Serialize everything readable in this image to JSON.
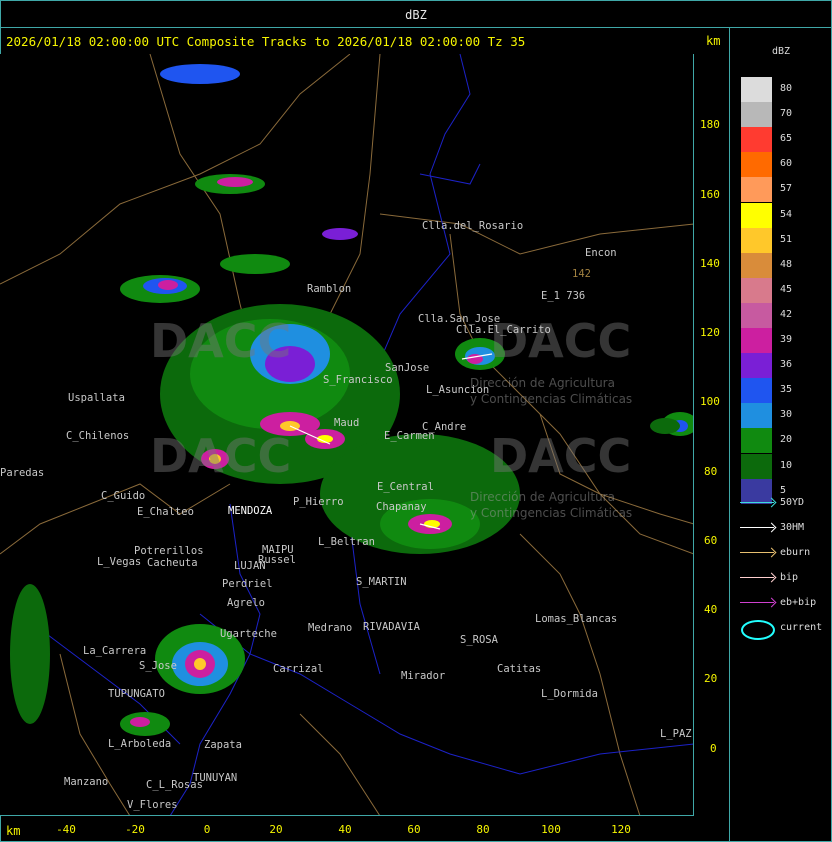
{
  "window": {
    "title": "dBZ"
  },
  "header": {
    "text": "2026/01/18 02:00:00 UTC Composite Tracks to 2026/01/18 02:00:00 Tz 35",
    "unit_top": "km",
    "unit_bottom": "km"
  },
  "axes": {
    "y_ticks": [
      "180",
      "160",
      "140",
      "120",
      "100",
      "80",
      "60",
      "40",
      "20",
      "0"
    ],
    "x_ticks": [
      "-40",
      "-20",
      "0",
      "20",
      "40",
      "60",
      "80",
      "100",
      "120"
    ]
  },
  "legend": {
    "title": "dBZ",
    "levels": [
      {
        "label": "80",
        "color": "#dcdcdc"
      },
      {
        "label": "70",
        "color": "#b8b8b8"
      },
      {
        "label": "65",
        "color": "#ff3b30"
      },
      {
        "label": "60",
        "color": "#ff6a00"
      },
      {
        "label": "57",
        "color": "#ff9a5a"
      },
      {
        "label": "54",
        "color": "#ffff00"
      },
      {
        "label": "51",
        "color": "#ffc82a"
      },
      {
        "label": "48",
        "color": "#d98c3a"
      },
      {
        "label": "45",
        "color": "#d87a8c"
      },
      {
        "label": "42",
        "color": "#c75aa0"
      },
      {
        "label": "39",
        "color": "#cc1fa0"
      },
      {
        "label": "36",
        "color": "#7a1fd6"
      },
      {
        "label": "35",
        "color": "#1f55f0"
      },
      {
        "label": "30",
        "color": "#1f8fe0"
      },
      {
        "label": "20",
        "color": "#108a10"
      },
      {
        "label": "10",
        "color": "#0c6a0c"
      },
      {
        "label": "5",
        "color": "#3a3aa0"
      }
    ],
    "tracks": [
      {
        "label": "50YD",
        "color": "#3cdcdc"
      },
      {
        "label": "30HM",
        "color": "#ffffff"
      },
      {
        "label": "eburn",
        "color": "#e8c070"
      },
      {
        "label": "bip",
        "color": "#ffd0d0"
      },
      {
        "label": "eb+bip",
        "color": "#d040d0"
      }
    ],
    "current_label": "current"
  },
  "places": [
    {
      "name": "Clla.del_Rosario"
    },
    {
      "name": "Encon"
    },
    {
      "name": "142"
    },
    {
      "name": "E_1 736"
    },
    {
      "name": "Ramblon"
    },
    {
      "name": "Clla.San_Jose"
    },
    {
      "name": "Clla.El_Carrito"
    },
    {
      "name": "Uspallata"
    },
    {
      "name": "S_Francisco"
    },
    {
      "name": "SanJose"
    },
    {
      "name": "L_Asuncion"
    },
    {
      "name": "C_Chilenos"
    },
    {
      "name": "Maud"
    },
    {
      "name": "E_Carmen"
    },
    {
      "name": "C_Andre"
    },
    {
      "name": "Paredas"
    },
    {
      "name": "E_Central"
    },
    {
      "name": "C_Guido"
    },
    {
      "name": "E_Chalteo"
    },
    {
      "name": "MENDOZA"
    },
    {
      "name": "P_Hierro"
    },
    {
      "name": "Chapanay"
    },
    {
      "name": "Potrerillos"
    },
    {
      "name": "Cacheuta"
    },
    {
      "name": "L_Vegas"
    },
    {
      "name": "LUJAN"
    },
    {
      "name": "MAIPU"
    },
    {
      "name": "Russel"
    },
    {
      "name": "Perdriel"
    },
    {
      "name": "Agrelo"
    },
    {
      "name": "S_MARTIN"
    },
    {
      "name": "L_Beltran"
    },
    {
      "name": "Lomas_Blancas"
    },
    {
      "name": "La_Carrera"
    },
    {
      "name": "S_Jose"
    },
    {
      "name": "Carrizal"
    },
    {
      "name": "Medrano"
    },
    {
      "name": "RIVADAVIA"
    },
    {
      "name": "S_ROSA"
    },
    {
      "name": "Catitas"
    },
    {
      "name": "Mirador"
    },
    {
      "name": "Ugarteche"
    },
    {
      "name": "TUPUNGATO"
    },
    {
      "name": "L_Dormida"
    },
    {
      "name": "L_Arboleda"
    },
    {
      "name": "Zapata"
    },
    {
      "name": "TUNUYAN"
    },
    {
      "name": "Manzano"
    },
    {
      "name": "V_Flores"
    },
    {
      "name": "C_L_Rosas"
    },
    {
      "name": "L_PAZ"
    }
  ],
  "watermark": {
    "logo_text": "DACC",
    "subtitle_1": "Dirección de Agricultura",
    "subtitle_2": "y Contingencias Climáticas"
  }
}
